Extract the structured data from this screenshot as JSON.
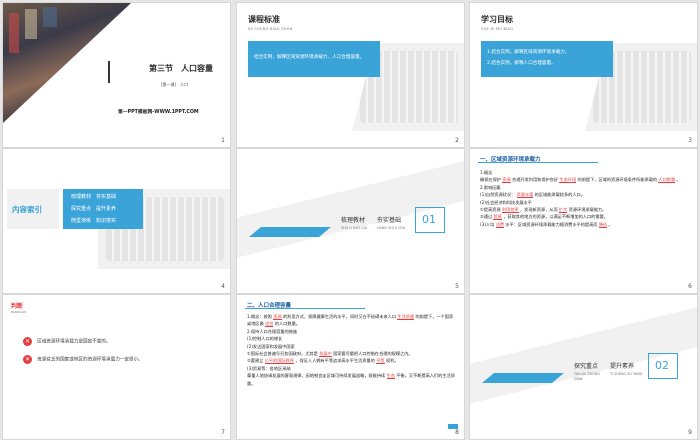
{
  "s1": {
    "section": "第三节　人口容量",
    "tag": "[第一课]　人口",
    "site": "第一PPT模板网-WWW.1PPT.COM",
    "num": "1"
  },
  "s2": {
    "title": "课程标准",
    "sub": "KE CHENG BIAO ZHUN",
    "text": "结合实例，解释区域资源环境承载力、人口合理容量。",
    "num": "2"
  },
  "s3": {
    "title": "学习目标",
    "sub": "XUE XI MU BIAO",
    "lines": [
      "1.结合实例，解释区域资源环境承载力。",
      "2.结合实例，解释人口合理容量。"
    ],
    "num": "3"
  },
  "s4": {
    "title": "内容索引",
    "items": [
      [
        "梳理教材",
        "夯实基础"
      ],
      [
        "探究重点",
        "提升素养"
      ],
      [
        "随堂演练",
        "知识落实"
      ]
    ],
    "num": "4"
  },
  "s5": {
    "t1": "梳理教材",
    "t2": "夯实基础",
    "s1": "SHU LI JIAO CAI",
    "s2": "HANG SHI JI CHU",
    "n": "01",
    "num": "5"
  },
  "s6": {
    "title": "一、区域资源环境承载力",
    "lines": [
      "1.概念",
      "确保在保护 _资源_ 合理开发利用和保护良好 _生态环境_ 的前提下，区域的资源环境条件所能承载的 _人口数量_ 。",
      "2.影响因素",
      "(1)自然资源状况： _资源丰富_ 的区域能承载较多的人口。",
      "(2)社会经济和科技发展水平",
      "①提高资源 _利用效率_ ，发现新资源，从而 _扩大_ 资源环境承载能力。",
      "②通过 _贸易_ ，获取其他地方的资源，以满足不断增加的人口的需要。",
      "(3)人均 _消费_ 水平：区域资源环境承载能力随消费水平的提高而 _降低_ 。"
    ],
    "num": "6"
  },
  "s7": {
    "title": "判断",
    "sub": "PANDUAN",
    "q1": "区域资源环境承载力是固定不变的。",
    "q2": "资源贫乏的国家或地区的资源环境承载力一定很小。",
    "num": "7"
  },
  "s8": {
    "title": "二、人口合理容量",
    "lines": [
      "1.概念：按照 _资源_ 的利用方式，保障健康生活的水平，同时又在不妨碍未来人口 _生活质量_ 的前提下，一个国家或地区最 _适宜_ 的人口数量。",
      "2.保持人口合理容量的措施",
      "(1)控制人口的增长",
      "(2)发达国家和发展中国家",
      "①国际社会普遍号召各国政府，尤其是 _发展中_ 国家要尽量把人口控制在合理的规模之内。",
      "②要建立 _公平的国际秩序_ ，保证人人拥有平等追求高水平生活质量的 _平等_ 权利。",
      "(3)贸易等：各地区采纳",
      "尊重人地协调发展的客观规律，因地制宜走区域可持续发展战略，既能持续 _生态_ 平衡，又不断提高人们的生活质量。"
    ],
    "num": "8"
  },
  "s9": {
    "t1": "探究重点",
    "t2": "提升素养",
    "s1": "TAN JIU ZHONG DIAN",
    "s2": "TI SHENG SU YANG",
    "n": "02",
    "num": "9"
  }
}
